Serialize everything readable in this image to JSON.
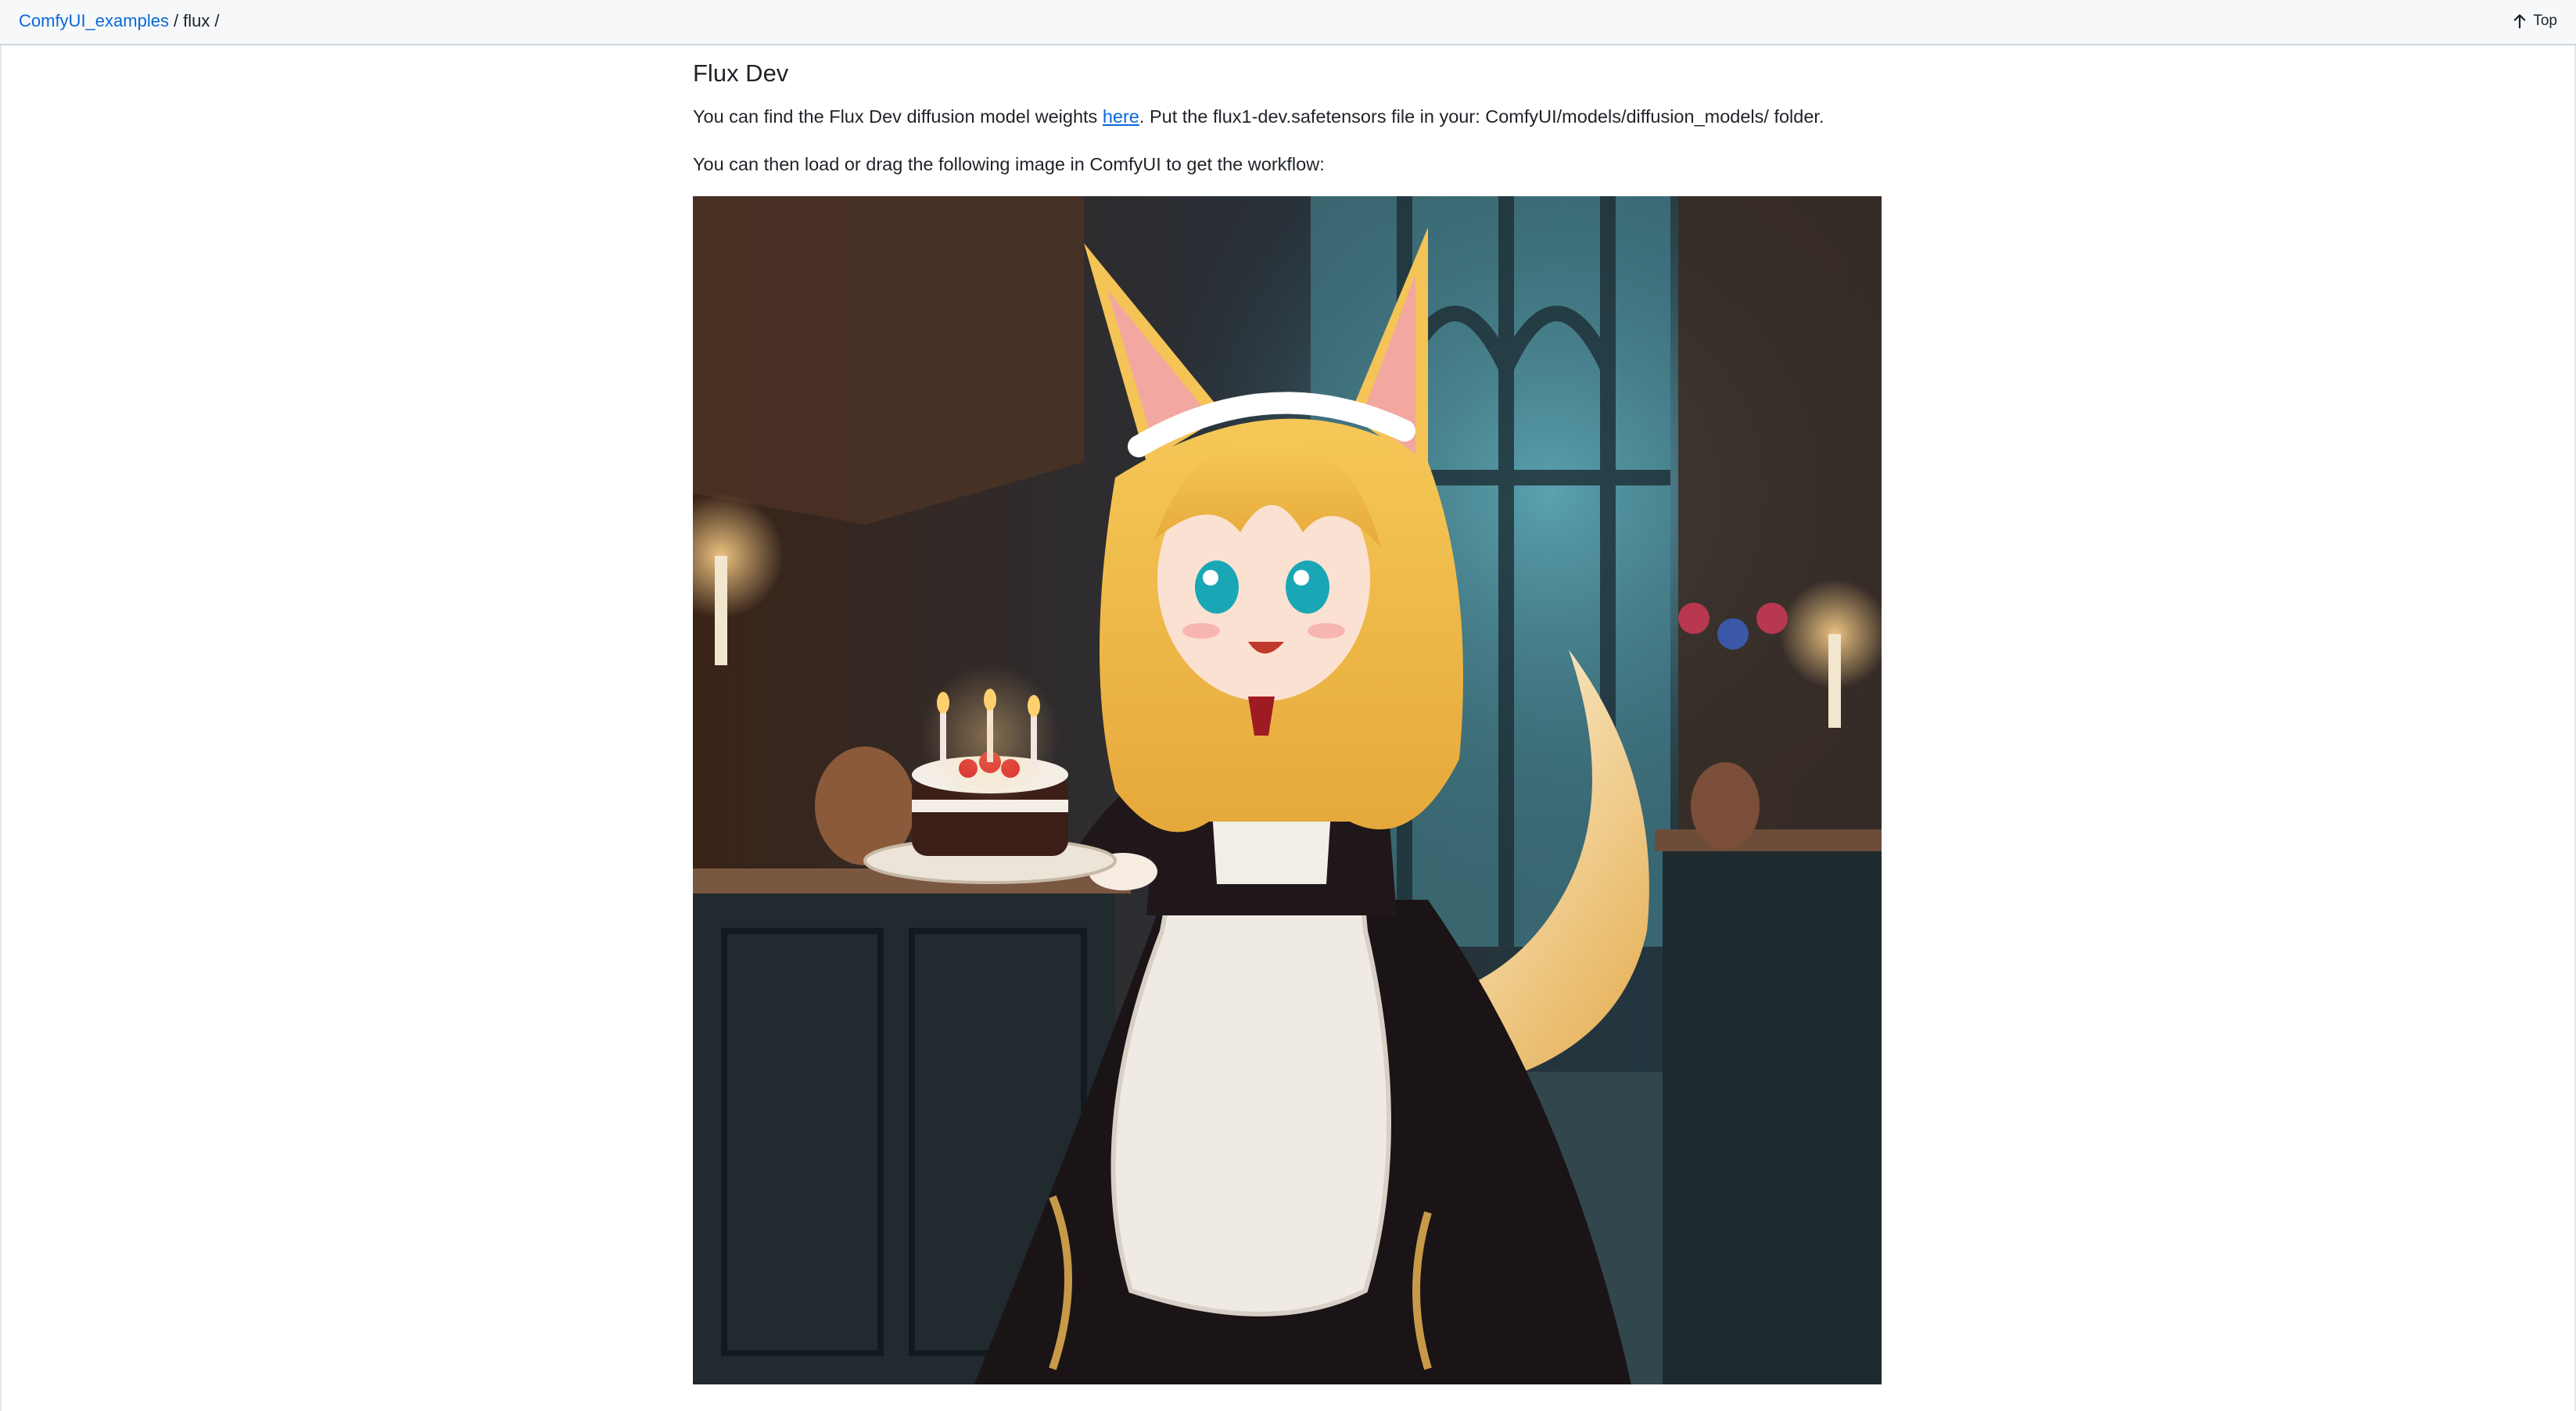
{
  "breadcrumb": {
    "root": "ComfyUI_examples",
    "sep1": "/",
    "current": "flux",
    "sep2": "/"
  },
  "top_button": {
    "label": "Top",
    "icon": "arrow-up-icon"
  },
  "article": {
    "title": "Flux Dev",
    "paragraph1": {
      "before": "You can find the Flux Dev diffusion model weights ",
      "link": "here",
      "after": ". Put the flux1-dev.safetensors file in your: ComfyUI/models/diffusion_models/ folder."
    },
    "paragraph2": "You can then load or drag the following image in ComfyUI to get the workflow:"
  },
  "colors": {
    "link": "#0969da",
    "text": "#1f2328",
    "topbar_bg": "#f6f8fa",
    "border": "#d0d7de"
  }
}
